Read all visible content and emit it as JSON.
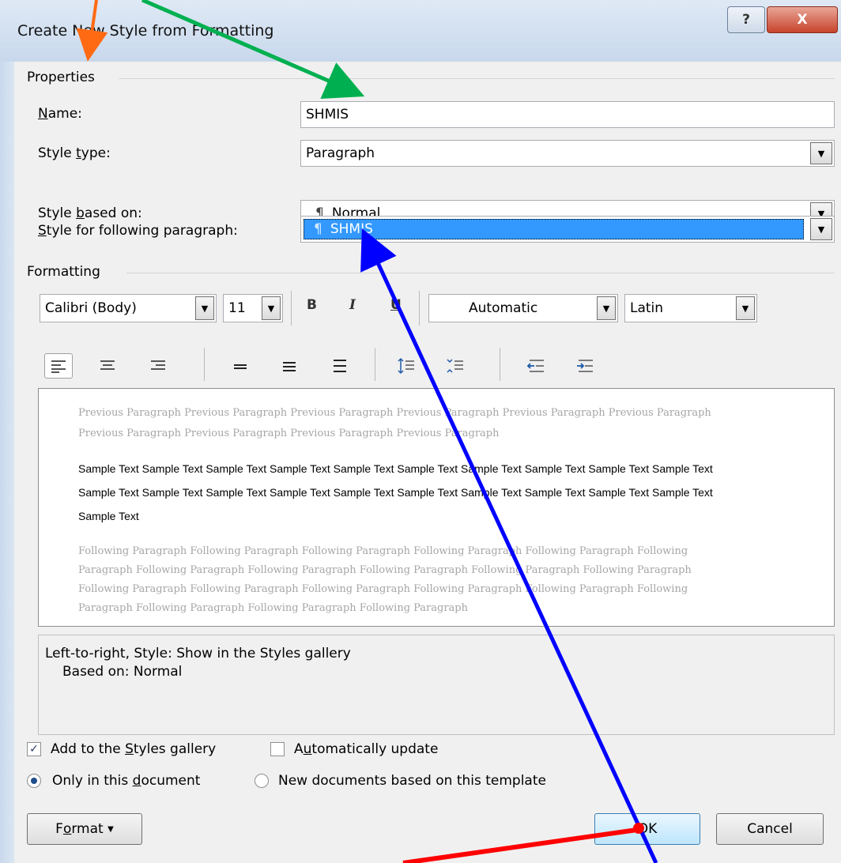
{
  "window": {
    "title": "Create New Style from Formatting",
    "help": "?",
    "close": "X"
  },
  "properties": {
    "heading": "Properties",
    "name_label": "Name:",
    "name_value": "SHMIS",
    "type_label": "Style type:",
    "type_value": "Paragraph",
    "based_label": "Style based on:",
    "based_value": "Normal",
    "following_label": "Style for following paragraph:",
    "following_value": "SHMIS",
    "pilcrow": "¶"
  },
  "formatting": {
    "heading": "Formatting",
    "font": "Calibri (Body)",
    "size": "11",
    "bold": "B",
    "italic": "I",
    "underline": "U",
    "color": "Automatic",
    "script": "Latin"
  },
  "preview": {
    "previous": "Previous Paragraph Previous Paragraph Previous Paragraph Previous Paragraph Previous Paragraph Previous Paragraph Previous Paragraph Previous Paragraph Previous Paragraph Previous Paragraph",
    "sample": "Sample Text Sample Text Sample Text Sample Text Sample Text Sample Text Sample Text Sample Text Sample Text Sample Text Sample Text Sample Text Sample Text Sample Text Sample Text Sample Text Sample Text Sample Text Sample Text Sample Text Sample Text",
    "following": "Following Paragraph Following Paragraph Following Paragraph Following Paragraph Following Paragraph Following Paragraph Following Paragraph Following Paragraph Following Paragraph Following Paragraph Following Paragraph Following Paragraph Following Paragraph Following Paragraph Following Paragraph Following Paragraph Following Paragraph Following Paragraph Following Paragraph Following Paragraph"
  },
  "description": {
    "line1": "Left-to-right, Style: Show in the Styles gallery",
    "line2": "Based on: Normal"
  },
  "options": {
    "add_gallery": "Add to the Styles gallery",
    "auto_update": "Automatically update",
    "only_doc": "Only in this document",
    "new_docs": "New documents based on this template"
  },
  "buttons": {
    "format": "Format",
    "ok": "OK",
    "cancel": "Cancel"
  },
  "annotation_colors": {
    "orange": "#ff6a13",
    "green": "#00b050",
    "blue": "#0000ff",
    "red": "#ff0000"
  }
}
